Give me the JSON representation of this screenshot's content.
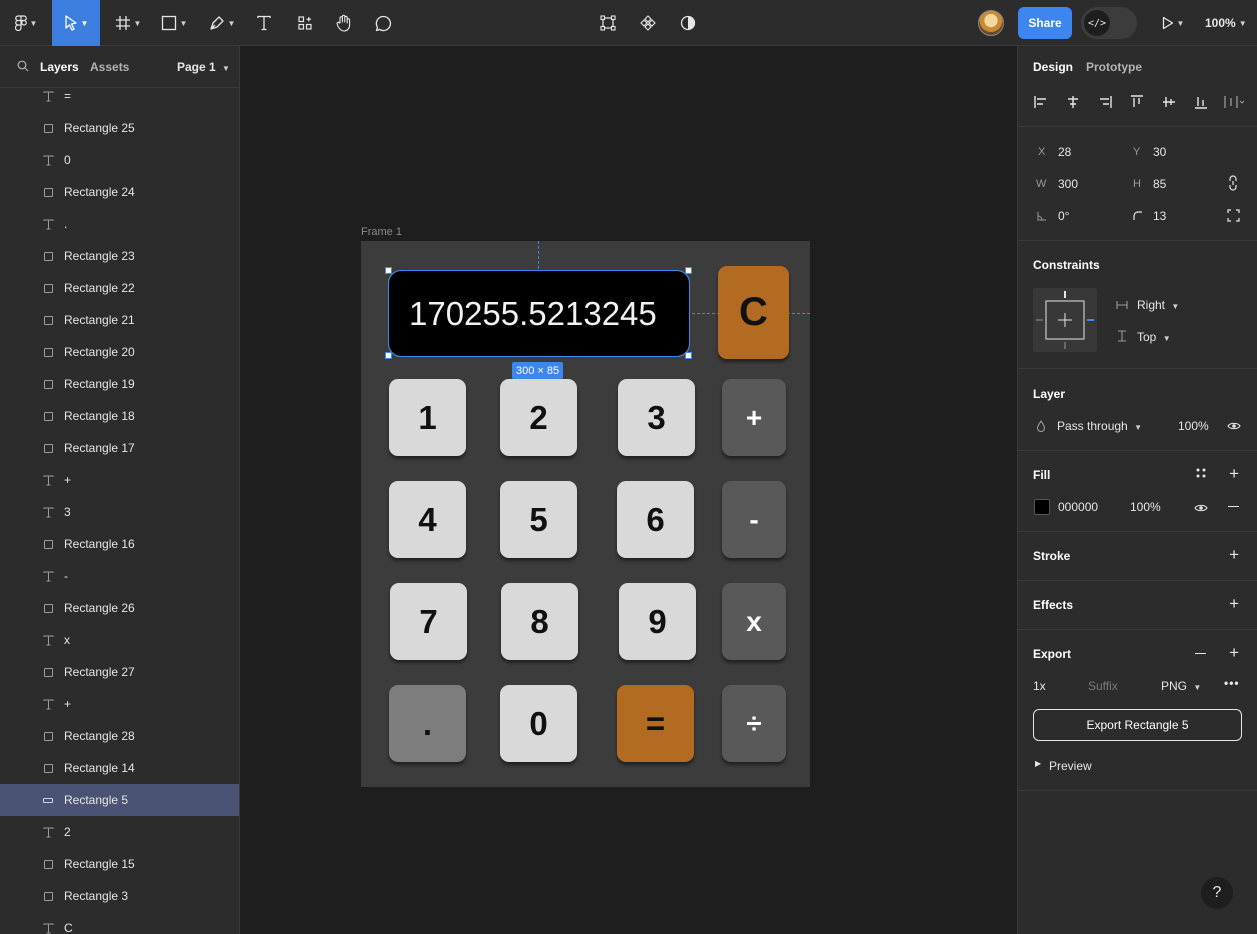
{
  "toolbar": {
    "share_label": "Share",
    "dev_mode_label": "</>",
    "zoom_label": "100%"
  },
  "left_panel": {
    "tab_layers": "Layers",
    "tab_assets": "Assets",
    "page_label": "Page 1",
    "layers": [
      {
        "type": "text",
        "name": "="
      },
      {
        "type": "rect",
        "name": "Rectangle 25"
      },
      {
        "type": "text",
        "name": "0"
      },
      {
        "type": "rect",
        "name": "Rectangle 24"
      },
      {
        "type": "text",
        "name": "."
      },
      {
        "type": "rect",
        "name": "Rectangle 23"
      },
      {
        "type": "rect",
        "name": "Rectangle 22"
      },
      {
        "type": "rect",
        "name": "Rectangle 21"
      },
      {
        "type": "rect",
        "name": "Rectangle 20"
      },
      {
        "type": "rect",
        "name": "Rectangle 19"
      },
      {
        "type": "rect",
        "name": "Rectangle 18"
      },
      {
        "type": "rect",
        "name": "Rectangle 17"
      },
      {
        "type": "text",
        "name": "+"
      },
      {
        "type": "text",
        "name": "3"
      },
      {
        "type": "rect",
        "name": "Rectangle 16"
      },
      {
        "type": "text",
        "name": "-"
      },
      {
        "type": "rect",
        "name": "Rectangle 26"
      },
      {
        "type": "text",
        "name": "x"
      },
      {
        "type": "rect",
        "name": "Rectangle 27"
      },
      {
        "type": "text",
        "name": "+"
      },
      {
        "type": "rect",
        "name": "Rectangle 28"
      },
      {
        "type": "rect",
        "name": "Rectangle 14"
      },
      {
        "type": "selected",
        "name": "Rectangle 5"
      },
      {
        "type": "text",
        "name": "2"
      },
      {
        "type": "rect",
        "name": "Rectangle 15"
      },
      {
        "type": "rect",
        "name": "Rectangle 3"
      },
      {
        "type": "text",
        "name": "C"
      }
    ]
  },
  "canvas": {
    "frame_label": "Frame 1",
    "display_value": "170255.5213245",
    "dim_badge": "300 × 85",
    "clear_label": "C",
    "keys": {
      "k1": "1",
      "k2": "2",
      "k3": "3",
      "plus": "+",
      "k4": "4",
      "k5": "5",
      "k6": "6",
      "minus": "-",
      "k7": "7",
      "k8": "8",
      "k9": "9",
      "times": "x",
      "dot": ".",
      "k0": "0",
      "equals": "=",
      "divide": "÷"
    }
  },
  "right_panel": {
    "tab_design": "Design",
    "tab_prototype": "Prototype",
    "x_label": "X",
    "x_value": "28",
    "y_label": "Y",
    "y_value": "30",
    "w_label": "W",
    "w_value": "300",
    "h_label": "H",
    "h_value": "85",
    "rotation_value": "0°",
    "radius_value": "13",
    "constraints_title": "Constraints",
    "constraint_h": "Right",
    "constraint_v": "Top",
    "layer_title": "Layer",
    "blend_mode": "Pass through",
    "layer_opacity": "100%",
    "fill_title": "Fill",
    "fill_hex": "000000",
    "fill_opacity": "100%",
    "stroke_title": "Stroke",
    "effects_title": "Effects",
    "export_title": "Export",
    "export_scale": "1x",
    "export_suffix_placeholder": "Suffix",
    "export_format": "PNG",
    "export_button": "Export Rectangle 5",
    "preview_label": "Preview",
    "help_label": "?"
  },
  "colors": {
    "accent": "#3d86f0",
    "orange_key": "#b36b22",
    "light_key": "#d9d9d9",
    "dark_key": "#595959"
  }
}
